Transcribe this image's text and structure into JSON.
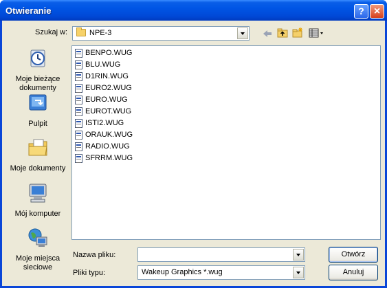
{
  "window": {
    "title": "Otwieranie"
  },
  "title_buttons": {
    "help": "?",
    "close": "×"
  },
  "lookin": {
    "label": "Szukaj w:",
    "value": "NPE-3"
  },
  "toolbar": {
    "back_icon": "back-arrow-icon",
    "up_icon": "up-folder-icon",
    "new_folder_icon": "new-folder-icon",
    "views_icon": "view-menu-icon"
  },
  "places": [
    {
      "label": "Moje bieżące dokumenty",
      "icon": "recent-documents-icon"
    },
    {
      "label": "Pulpit",
      "icon": "desktop-icon"
    },
    {
      "label": "Moje dokumenty",
      "icon": "my-documents-icon"
    },
    {
      "label": "Mój komputer",
      "icon": "my-computer-icon"
    },
    {
      "label": "Moje miejsca sieciowe",
      "icon": "network-places-icon"
    }
  ],
  "files": [
    {
      "name": "BENPO.WUG"
    },
    {
      "name": "BLU.WUG"
    },
    {
      "name": "D1RIN.WUG"
    },
    {
      "name": "EURO2.WUG"
    },
    {
      "name": "EURO.WUG"
    },
    {
      "name": "EUROT.WUG"
    },
    {
      "name": "ISTI2.WUG"
    },
    {
      "name": "ORAUK.WUG"
    },
    {
      "name": "RADIO.WUG"
    },
    {
      "name": "SFRRM.WUG"
    }
  ],
  "filename": {
    "label": "Nazwa pliku:",
    "value": ""
  },
  "filetype": {
    "label": "Pliki typu:",
    "value": "Wakeup Graphics *.wug"
  },
  "buttons": {
    "open": "Otwórz",
    "cancel": "Anuluj"
  },
  "colors": {
    "titlebar": "#0055e5",
    "client": "#ece9d8",
    "border": "#7f9db9"
  }
}
